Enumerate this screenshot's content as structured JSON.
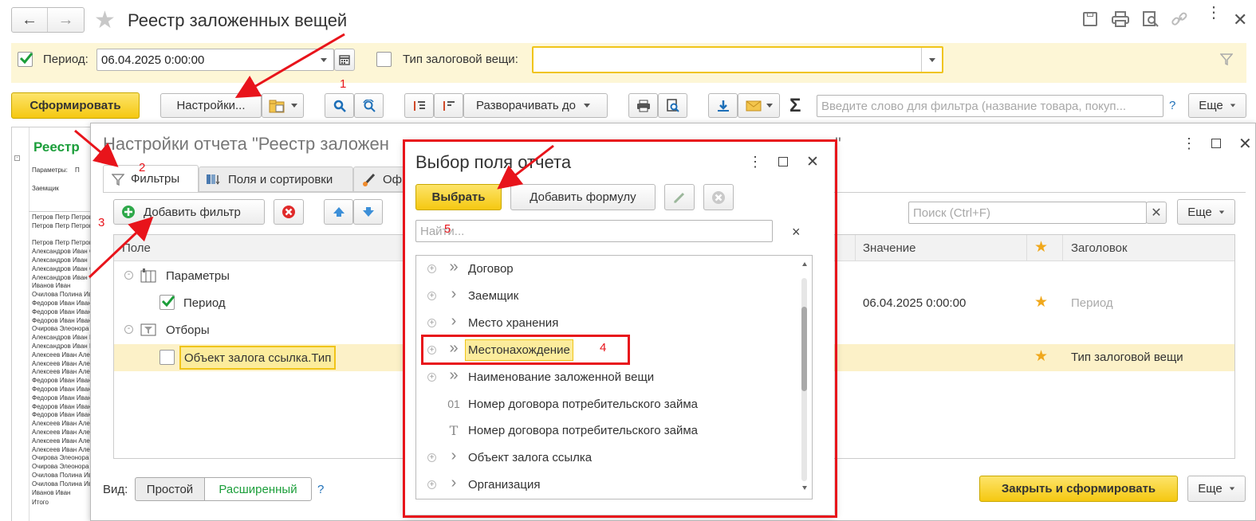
{
  "window": {
    "title": "Реестр заложенных вещей",
    "nav_back": "←",
    "nav_forward": "→"
  },
  "params": {
    "period_label": "Период:",
    "period_value": "06.04.2025  0:00:00",
    "type_label": "Тип залоговой вещи:"
  },
  "toolbar": {
    "generate": "Сформировать",
    "settings": "Настройки...",
    "expand_to": "Разворачивать до",
    "filter_placeholder": "Введите слово для фильтра (название товара, покуп...",
    "help": "?",
    "more": "Еще"
  },
  "report_preview": {
    "title": "Реестр",
    "params_label": "Параметры:",
    "params_cut": "П",
    "column": "Заемщик",
    "rows": [
      "Петров Петр Петров",
      "Петров Петр Петров",
      "",
      "Петров Петр Петров",
      "Александров Иван С",
      "Александров Иван",
      "Александров Иван С",
      "Александров Иван С",
      "Иванов Иван",
      "Очилова Полина Ив",
      "Федоров Иван Иван",
      "Федоров Иван Иван",
      "Федоров Иван Иван",
      "Очирова Элеонора Е",
      "Александров Иван И",
      "Александров Иван И",
      "Алексеев Иван Алек",
      "Алексеев Иван Алек",
      "Алексеев Иван Алек",
      "Федоров Иван Иван",
      "Федоров Иван Иван",
      "Федоров Иван Иван",
      "Федоров Иван Иван",
      "Федоров Иван Иван",
      "Алексеев Иван Алек",
      "Алексеев Иван Алек",
      "Алексеев Иван Алек",
      "Алексеев Иван Алек",
      "Очирова Элеонора Е",
      "Очирова Элеонора Е",
      "Очилова Полина Ив",
      "Очилова Полина Ив",
      "Иванов Иван",
      "Итого"
    ]
  },
  "settings": {
    "title": "Настройки отчета \"Реестр заложен",
    "title_tail": "\"",
    "tabs": [
      "Фильтры",
      "Поля и сортировки",
      "Оф"
    ],
    "add_filter": "Добавить фильтр",
    "search_placeholder": "Поиск (Ctrl+F)",
    "more": "Еще",
    "columns": {
      "field": "Поле",
      "value": "Значение",
      "title": "Заголовок"
    },
    "tree": [
      {
        "label": "Параметры",
        "value": "",
        "title": ""
      },
      {
        "label": "Период",
        "value": "06.04.2025 0:00:00",
        "title": "Период"
      },
      {
        "label": "Отборы",
        "value": "",
        "title": ""
      },
      {
        "label": "Объект залога ссылка.Тип",
        "value": "",
        "title": "Тип залоговой вещи"
      }
    ],
    "view_label": "Вид:",
    "view_simple": "Простой",
    "view_extended": "Расширенный",
    "help": "?",
    "close_generate": "Закрыть и сформировать",
    "more_bottom": "Еще"
  },
  "field_dialog": {
    "title": "Выбор поля отчета",
    "select": "Выбрать",
    "add_formula": "Добавить формулу",
    "search_placeholder": "Найти...",
    "clear": "×",
    "items": [
      {
        "prefix": "»",
        "label": "Договор"
      },
      {
        "prefix": "›",
        "label": "Заемщик"
      },
      {
        "prefix": "›",
        "label": "Место хранения"
      },
      {
        "prefix": "»",
        "label": "Местонахождение"
      },
      {
        "prefix": "»",
        "label": "Наименование заложенной вещи"
      },
      {
        "prefix": "01",
        "label": "Номер договора потребительского займа"
      },
      {
        "prefix": "T",
        "label": "Номер договора потребительского займа"
      },
      {
        "prefix": "›",
        "label": "Объект залога ссылка"
      },
      {
        "prefix": "›",
        "label": "Организация"
      }
    ]
  },
  "annotations": [
    "1",
    "2",
    "3",
    "4",
    "5"
  ],
  "colors": {
    "accent_yellow": "#f5c811",
    "annotation_red": "#e8141b",
    "green_check": "#1b9e3a"
  }
}
